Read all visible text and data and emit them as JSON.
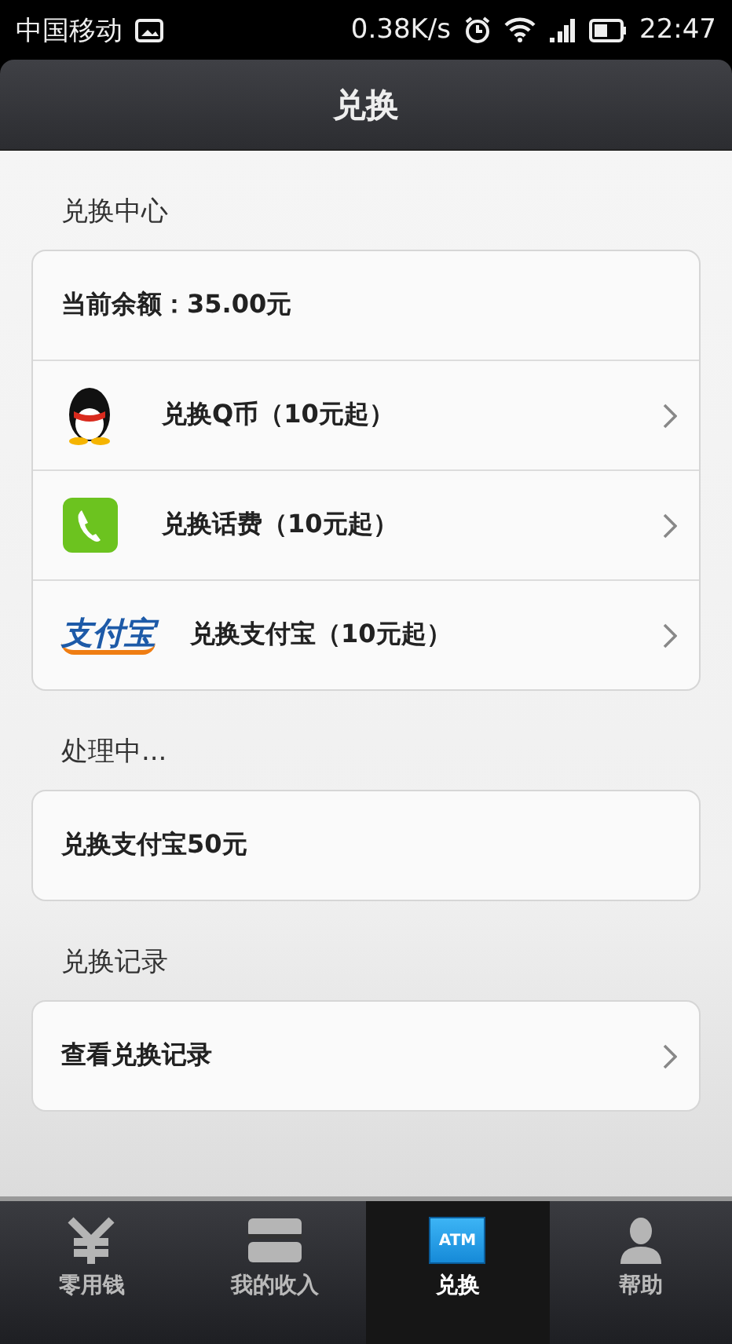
{
  "status_bar": {
    "carrier": "中国移动",
    "speed": "0.38K/s",
    "time": "22:47"
  },
  "header": {
    "title": "兑换"
  },
  "sections": [
    {
      "title": "兑换中心",
      "rows": [
        {
          "kind": "text",
          "label": "当前余额：35.00元",
          "chevron": false
        },
        {
          "kind": "bird",
          "label": "兑换Q币（10元起）",
          "chevron": true
        },
        {
          "kind": "phone",
          "label": "兑换话费（10元起）",
          "chevron": true
        },
        {
          "kind": "logo",
          "logo": "支付宝",
          "label": "兑换支付宝（10元起）",
          "chevron": true
        }
      ]
    },
    {
      "title": "处理中...",
      "rows": [
        {
          "kind": "text",
          "label": "兑换支付宝50元",
          "chevron": false
        }
      ]
    },
    {
      "title": "兑换记录",
      "rows": [
        {
          "kind": "text",
          "label": "查看兑换记录",
          "chevron": true
        }
      ]
    }
  ],
  "tabs": [
    {
      "kind": "yen",
      "label": "零用钱",
      "selected": false
    },
    {
      "kind": "cards",
      "label": "我的收入",
      "selected": false
    },
    {
      "kind": "atm",
      "icon_text": "ATM",
      "label": "兑换",
      "selected": true
    },
    {
      "kind": "person",
      "label": "帮助",
      "selected": false
    }
  ]
}
